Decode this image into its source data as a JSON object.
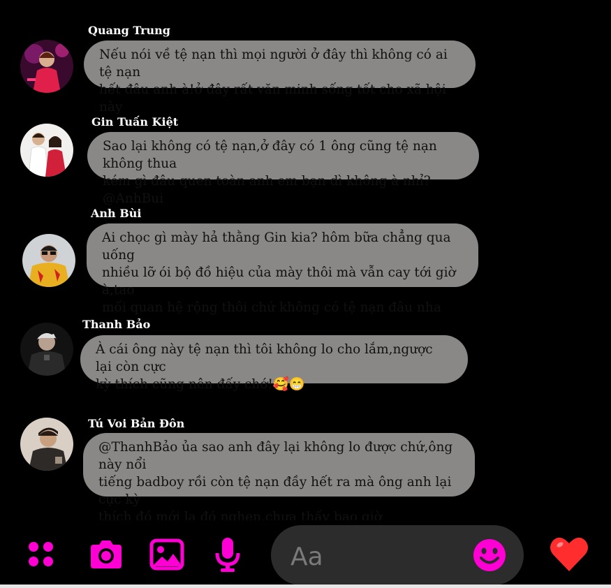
{
  "messages": [
    {
      "sender": "Quang Trung",
      "text": "Nếu nói về tệ nạn thì mọi người ở đây thì không có ai tệ nạn\nhết đâu anh à!ở đây rất văn minh sống tốt cho xã hội này"
    },
    {
      "sender": "Gin Tuấn Kiệt",
      "text": "Sao lại không có tệ nạn,ở đây có 1 ông cũng tệ nạn không thua\nkém gì đâu quen toàn anh em bạn dì không à nhỉ? @AnhBui"
    },
    {
      "sender": "Anh Bùi",
      "text": "Ai chọc gì mày hả thằng Gin kia? hôm bữa chẳng qua uống\nnhiều lỡ ói bộ đồ hiệu của mày thôi mà vẫn cay tới giờ à,tao\nmối quan hệ rộng thôi chứ không có tệ nạn đâu nha"
    },
    {
      "sender": "Thanh Bảo",
      "text": "À cái ông này tệ nạn thì tôi không lo cho lắm,ngược lại còn cực\nkỳ thích cũng nên đấy chớ!🥰😁"
    },
    {
      "sender": "Tú Voi Bản Đôn",
      "text": "@ThanhBảo ủa sao anh đây lại không lo được chứ,ông này nổi\ntiếng badboy rồi còn tệ nạn đầy hết ra mà ông anh lại cực kỳ\nthích đó mới lạ đó nghen,chưa thấy bao giờ"
    }
  ],
  "composer": {
    "placeholder": "Aa"
  },
  "colors": {
    "accent": "#ff00d4",
    "bubble": "#8a8886",
    "background": "#000000",
    "heart": "#ff2d2d"
  },
  "icons": {
    "apps": "grid-dots-icon",
    "camera": "camera-icon",
    "gallery": "image-icon",
    "mic": "microphone-icon",
    "emoji": "smile-emoji-icon",
    "like": "heart-icon"
  }
}
